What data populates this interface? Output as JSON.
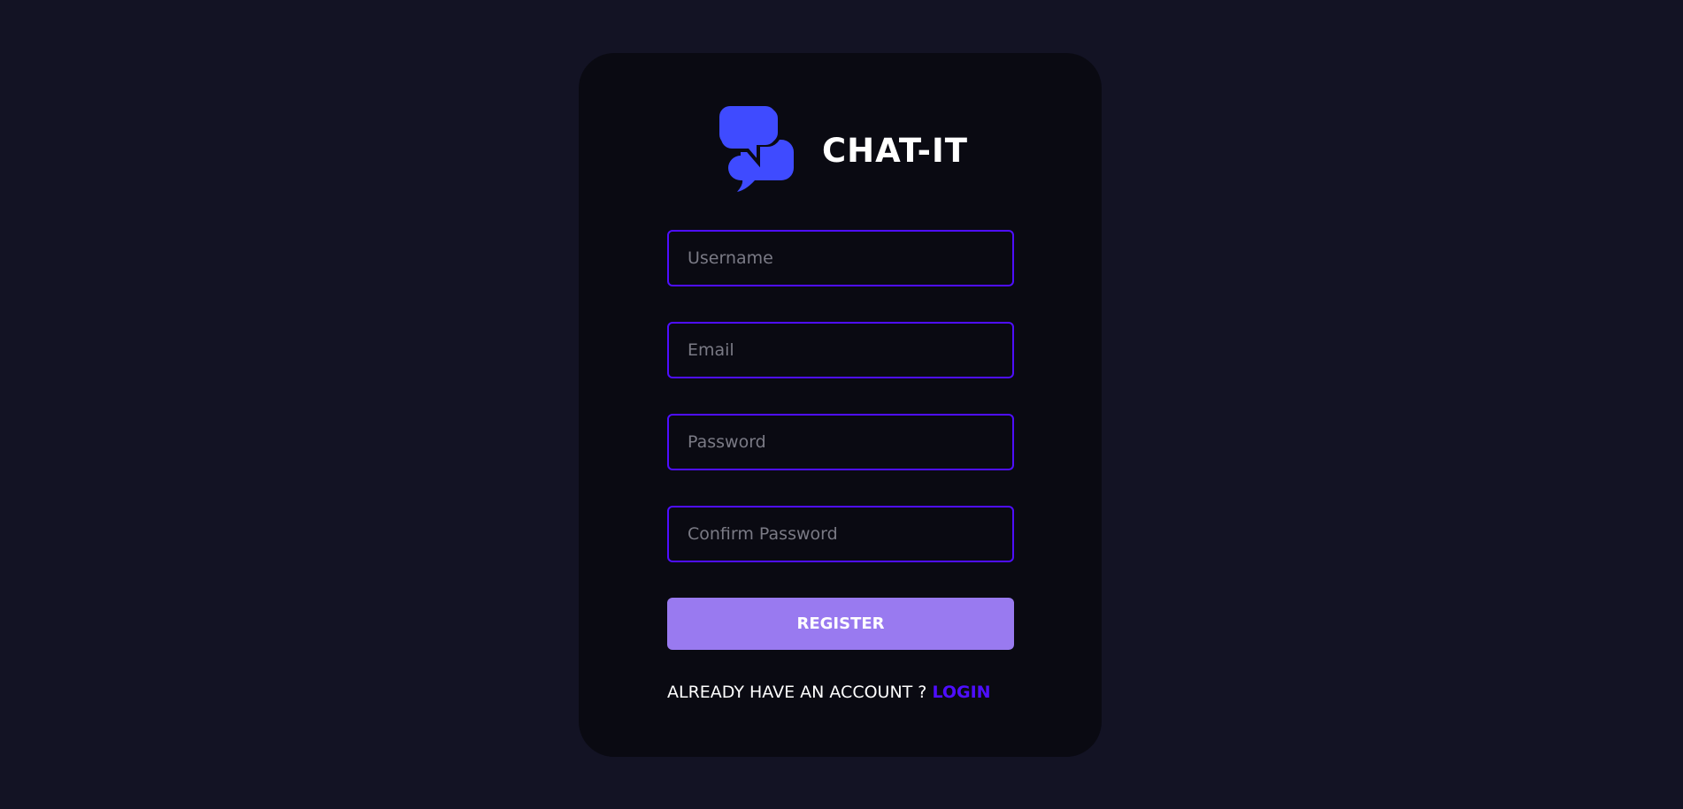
{
  "brand": {
    "name": "CHAT-IT",
    "logo_icon": "chat-bubbles-icon",
    "logo_color": "#3f4bff"
  },
  "form": {
    "username_placeholder": "Username",
    "email_placeholder": "Email",
    "password_placeholder": "Password",
    "confirm_password_placeholder": "Confirm Password",
    "register_label": "REGISTER"
  },
  "footer": {
    "prompt": "ALREADY HAVE AN ACCOUNT ?",
    "login_label": "LOGIN"
  },
  "colors": {
    "page_background": "#131324",
    "card_background": "#0a0a12",
    "accent": "#4e0eff",
    "button": "#997af0",
    "text": "#ffffff",
    "placeholder": "#7a7a85"
  }
}
